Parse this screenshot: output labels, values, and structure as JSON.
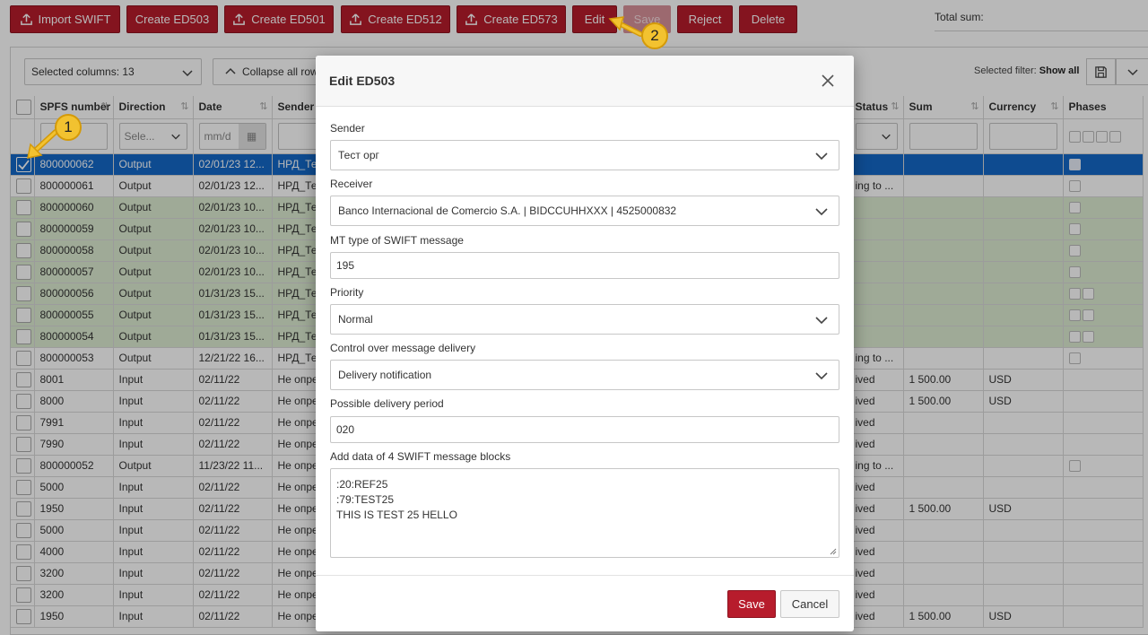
{
  "toolbar": {
    "buttons": [
      {
        "label": "Import SWIFT",
        "icon": "upload-icon"
      },
      {
        "label": "Create ED503",
        "icon": ""
      },
      {
        "label": "Create ED501",
        "icon": "upload-icon"
      },
      {
        "label": "Create ED512",
        "icon": "upload-icon"
      },
      {
        "label": "Create ED573",
        "icon": "upload-icon"
      },
      {
        "label": "Edit",
        "icon": ""
      },
      {
        "label": "Save",
        "icon": ""
      },
      {
        "label": "Reject",
        "icon": ""
      },
      {
        "label": "Delete",
        "icon": ""
      }
    ],
    "total_sum_label": "Total sum:"
  },
  "grid_controls": {
    "selected_columns": "Selected columns: 13",
    "collapse_label": "Collapse all rows",
    "selected_filter_label": "Selected filter:",
    "selected_filter_value": "Show all"
  },
  "columns": [
    "SPFS number",
    "Direction",
    "Date",
    "Sender",
    "Status",
    "Sum",
    "Currency",
    "Phases"
  ],
  "filters": {
    "direction_placeholder": "Sele...",
    "date_placeholder": "mm/d"
  },
  "rows": [
    {
      "spfs": "800000062",
      "direction": "Output",
      "date": "02/01/23 12...",
      "sender": "НРД_Тес",
      "status": "",
      "sum": "",
      "currency": "",
      "phases": 1,
      "style": "sel"
    },
    {
      "spfs": "800000061",
      "direction": "Output",
      "date": "02/01/23 12...",
      "sender": "НРД_Тес",
      "status": "ing to ...",
      "sum": "",
      "currency": "",
      "phases": 1,
      "style": ""
    },
    {
      "spfs": "800000060",
      "direction": "Output",
      "date": "02/01/23 10...",
      "sender": "НРД_Тес",
      "status": "",
      "sum": "",
      "currency": "",
      "phases": 1,
      "style": "green"
    },
    {
      "spfs": "800000059",
      "direction": "Output",
      "date": "02/01/23 10...",
      "sender": "НРД_Тес",
      "status": "",
      "sum": "",
      "currency": "",
      "phases": 1,
      "style": "green"
    },
    {
      "spfs": "800000058",
      "direction": "Output",
      "date": "02/01/23 10...",
      "sender": "НРД_Тес",
      "status": "",
      "sum": "",
      "currency": "",
      "phases": 1,
      "style": "green"
    },
    {
      "spfs": "800000057",
      "direction": "Output",
      "date": "02/01/23 10...",
      "sender": "НРД_Тес",
      "status": "",
      "sum": "",
      "currency": "",
      "phases": 1,
      "style": "green"
    },
    {
      "spfs": "800000056",
      "direction": "Output",
      "date": "01/31/23 15...",
      "sender": "НРД_Тес",
      "status": "",
      "sum": "",
      "currency": "",
      "phases": 2,
      "style": "green"
    },
    {
      "spfs": "800000055",
      "direction": "Output",
      "date": "01/31/23 15...",
      "sender": "НРД_Тес",
      "status": "",
      "sum": "",
      "currency": "",
      "phases": 2,
      "style": "green"
    },
    {
      "spfs": "800000054",
      "direction": "Output",
      "date": "01/31/23 15...",
      "sender": "НРД_Тес",
      "status": "",
      "sum": "",
      "currency": "",
      "phases": 2,
      "style": "green"
    },
    {
      "spfs": "800000053",
      "direction": "Output",
      "date": "12/21/22 16...",
      "sender": "НРД_Тес",
      "status": "ing to ...",
      "sum": "",
      "currency": "",
      "phases": 1,
      "style": ""
    },
    {
      "spfs": "8001",
      "direction": "Input",
      "date": "02/11/22",
      "sender": "Не опре",
      "status": "ived",
      "sum": "1 500.00",
      "currency": "USD",
      "phases": 0,
      "style": ""
    },
    {
      "spfs": "8000",
      "direction": "Input",
      "date": "02/11/22",
      "sender": "Не опре",
      "status": "ived",
      "sum": "1 500.00",
      "currency": "USD",
      "phases": 0,
      "style": ""
    },
    {
      "spfs": "7991",
      "direction": "Input",
      "date": "02/11/22",
      "sender": "Не опре",
      "status": "ived",
      "sum": "",
      "currency": "",
      "phases": 0,
      "style": ""
    },
    {
      "spfs": "7990",
      "direction": "Input",
      "date": "02/11/22",
      "sender": "Не опре",
      "status": "ived",
      "sum": "",
      "currency": "",
      "phases": 0,
      "style": ""
    },
    {
      "spfs": "800000052",
      "direction": "Output",
      "date": "11/23/22 11...",
      "sender": "Не опре",
      "status": "ing to ...",
      "sum": "",
      "currency": "",
      "phases": 1,
      "style": ""
    },
    {
      "spfs": "5000",
      "direction": "Input",
      "date": "02/11/22",
      "sender": "Не опре",
      "status": "ived",
      "sum": "",
      "currency": "",
      "phases": 0,
      "style": ""
    },
    {
      "spfs": "1950",
      "direction": "Input",
      "date": "02/11/22",
      "sender": "Не опре",
      "status": "ived",
      "sum": "1 500.00",
      "currency": "USD",
      "phases": 0,
      "style": ""
    },
    {
      "spfs": "5000",
      "direction": "Input",
      "date": "02/11/22",
      "sender": "Не опре",
      "status": "ived",
      "sum": "",
      "currency": "",
      "phases": 0,
      "style": ""
    },
    {
      "spfs": "4000",
      "direction": "Input",
      "date": "02/11/22",
      "sender": "Не опре",
      "status": "ived",
      "sum": "",
      "currency": "",
      "phases": 0,
      "style": ""
    },
    {
      "spfs": "3200",
      "direction": "Input",
      "date": "02/11/22",
      "sender": "Не опре",
      "status": "ived",
      "sum": "",
      "currency": "",
      "phases": 0,
      "style": ""
    },
    {
      "spfs": "3200",
      "direction": "Input",
      "date": "02/11/22",
      "sender": "Не опре",
      "status": "ived",
      "sum": "",
      "currency": "",
      "phases": 0,
      "style": ""
    },
    {
      "spfs": "1950",
      "direction": "Input",
      "date": "02/11/22",
      "sender": "Не опре",
      "status": "ived",
      "sum": "1 500.00",
      "currency": "USD",
      "phases": 0,
      "style": ""
    }
  ],
  "modal": {
    "title": "Edit ED503",
    "sender_label": "Sender",
    "sender_value": "Тест орг",
    "receiver_label": "Receiver",
    "receiver_value": "Banco Internacional de Comercio S.A. | BIDCCUHHXXX | 4525000832",
    "mt_type_label": "MT type of SWIFT message",
    "mt_type_value": "195",
    "priority_label": "Priority",
    "priority_value": "Normal",
    "control_label": "Control over message delivery",
    "control_value": "Delivery notification",
    "period_label": "Possible delivery period",
    "period_value": "020",
    "blocks_label": "Add data of 4 SWIFT message blocks",
    "blocks_lines": [
      ":20:REF25",
      ":79:TEST25",
      "THIS IS TEST 25 HELLO"
    ],
    "save_label": "Save",
    "cancel_label": "Cancel"
  },
  "callouts": {
    "first": "1",
    "second": "2"
  },
  "colors": {
    "brand_red": "#b71c2c",
    "selected_row": "#1468c8",
    "green_row": "#ddecd2",
    "callout": "#f2c230"
  }
}
